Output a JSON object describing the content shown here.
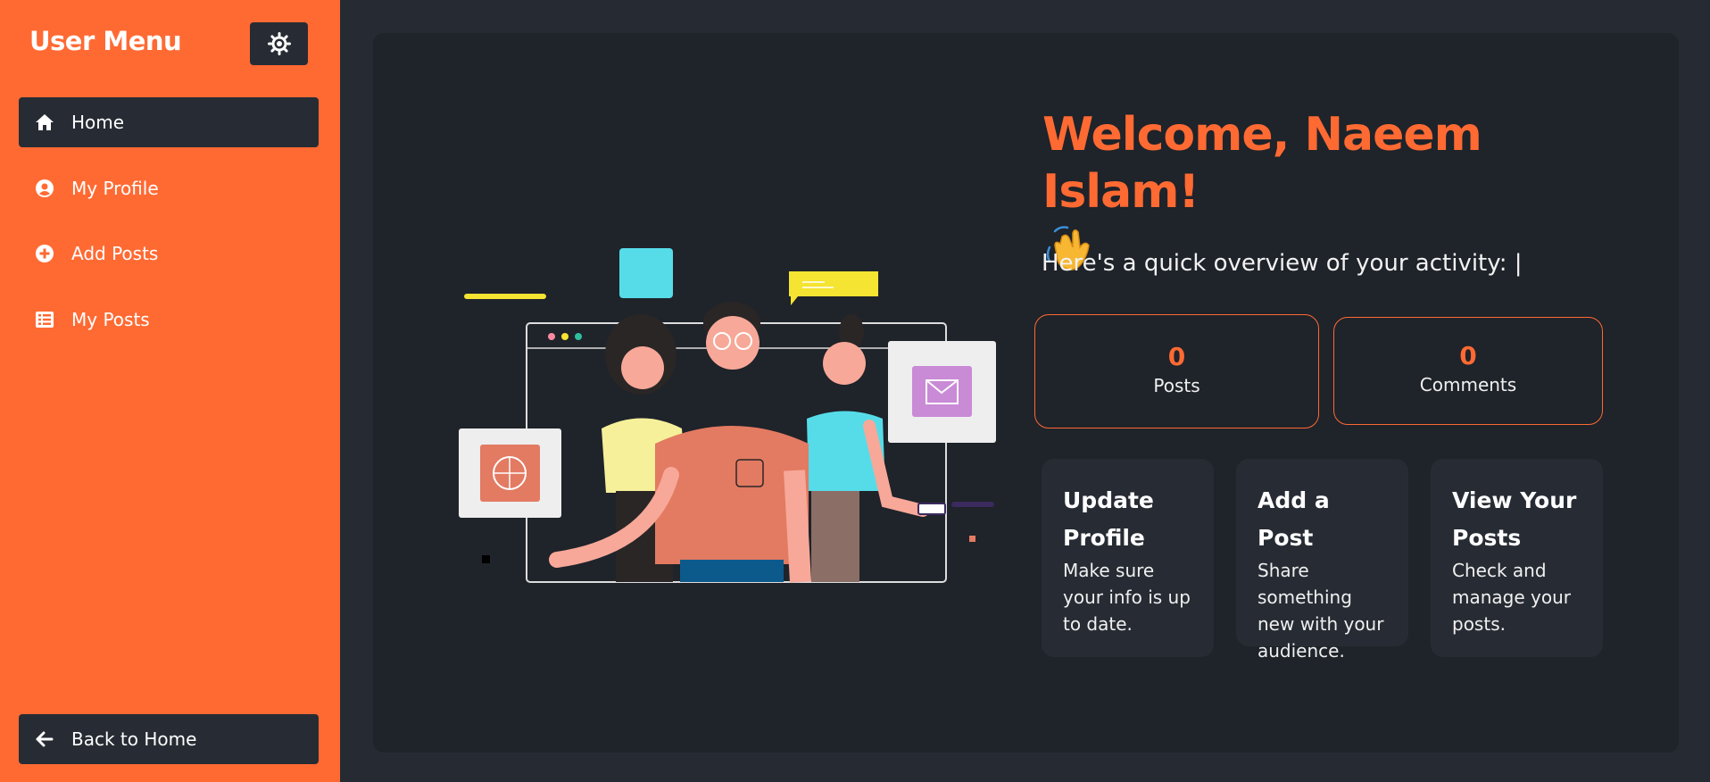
{
  "sidebar": {
    "title": "User Menu",
    "theme_toggle_icon": "sun-icon",
    "items": [
      {
        "label": "Home",
        "icon": "home-icon",
        "active": true
      },
      {
        "label": "My Profile",
        "icon": "user-circle-icon",
        "active": false
      },
      {
        "label": "Add Posts",
        "icon": "plus-circle-icon",
        "active": false
      },
      {
        "label": "My Posts",
        "icon": "list-icon",
        "active": false
      }
    ],
    "back_label": "Back to Home",
    "back_icon": "arrow-left-icon"
  },
  "main": {
    "welcome": "Welcome, Naeem Islam!",
    "wave_icon": "waving-hand-icon",
    "overview": "Here's a quick overview of your activity: |",
    "stats": [
      {
        "value": "0",
        "label": "Posts"
      },
      {
        "value": "0",
        "label": "Comments"
      }
    ],
    "cards": [
      {
        "title": "Update Profile",
        "desc": "Make sure your info is up to date."
      },
      {
        "title": "Add a Post",
        "desc": "Share something new with your audience."
      },
      {
        "title": "View Your Posts",
        "desc": "Check and manage your posts."
      }
    ]
  },
  "colors": {
    "accent": "#ff6a33",
    "sidebar_bg": "#ff6a33",
    "panel_bg": "#1f232a",
    "page_bg": "#262b33",
    "button_bg": "#272c34"
  }
}
